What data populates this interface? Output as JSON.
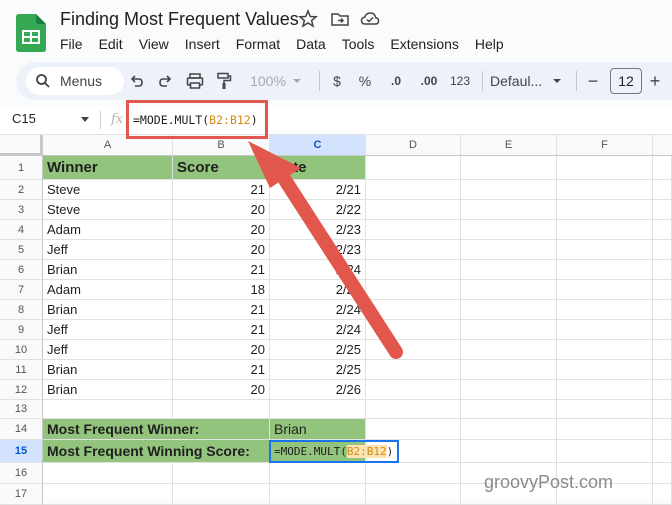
{
  "app": {
    "title": "Finding Most Frequent Values",
    "menus": [
      "File",
      "Edit",
      "View",
      "Insert",
      "Format",
      "Data",
      "Tools",
      "Extensions",
      "Help"
    ]
  },
  "toolbar": {
    "search_label": "Menus",
    "zoom": "100%",
    "currency": "$",
    "percent": "%",
    "decrease_decimals": ".0",
    "increase_decimals": ".00",
    "number_format": "123",
    "font": "Defaul...",
    "font_size": "12",
    "minus": "−",
    "plus": "+"
  },
  "formula_bar": {
    "cell_ref": "C15",
    "fx": "fx",
    "formula": "=MODE.MULT(B2:B12)",
    "formula_prefix": "=MODE.MULT(",
    "formula_range": "B2:B12",
    "formula_suffix": ")"
  },
  "columns": [
    "A",
    "B",
    "C",
    "D",
    "E",
    "F"
  ],
  "rows": [
    "1",
    "2",
    "3",
    "4",
    "5",
    "6",
    "7",
    "8",
    "9",
    "10",
    "11",
    "12",
    "13",
    "14",
    "15",
    "16",
    "17"
  ],
  "table": {
    "headers": [
      "Winner",
      "Score",
      "Date"
    ],
    "data": [
      [
        "Steve",
        "21",
        "2/21"
      ],
      [
        "Steve",
        "20",
        "2/22"
      ],
      [
        "Adam",
        "20",
        "2/23"
      ],
      [
        "Jeff",
        "20",
        "2/23"
      ],
      [
        "Brian",
        "21",
        "2/24"
      ],
      [
        "Adam",
        "18",
        "2/24"
      ],
      [
        "Brian",
        "21",
        "2/24"
      ],
      [
        "Jeff",
        "21",
        "2/24"
      ],
      [
        "Jeff",
        "20",
        "2/25"
      ],
      [
        "Brian",
        "21",
        "2/25"
      ],
      [
        "Brian",
        "20",
        "2/26"
      ]
    ]
  },
  "summary": {
    "winner_label": "Most Frequent Winner:",
    "winner_value": "Brian",
    "score_label": "Most Frequent Winning Score:",
    "score_formula_prefix": "=MODE.MULT(",
    "score_formula_range": "B2:B12",
    "score_formula_suffix": ")"
  },
  "watermark": "groovyPost.com",
  "colors": {
    "header_green": "#93c47d",
    "highlight_red": "#e2574c",
    "selection_blue": "#1a73e8",
    "range_orange": "#d58a15"
  }
}
